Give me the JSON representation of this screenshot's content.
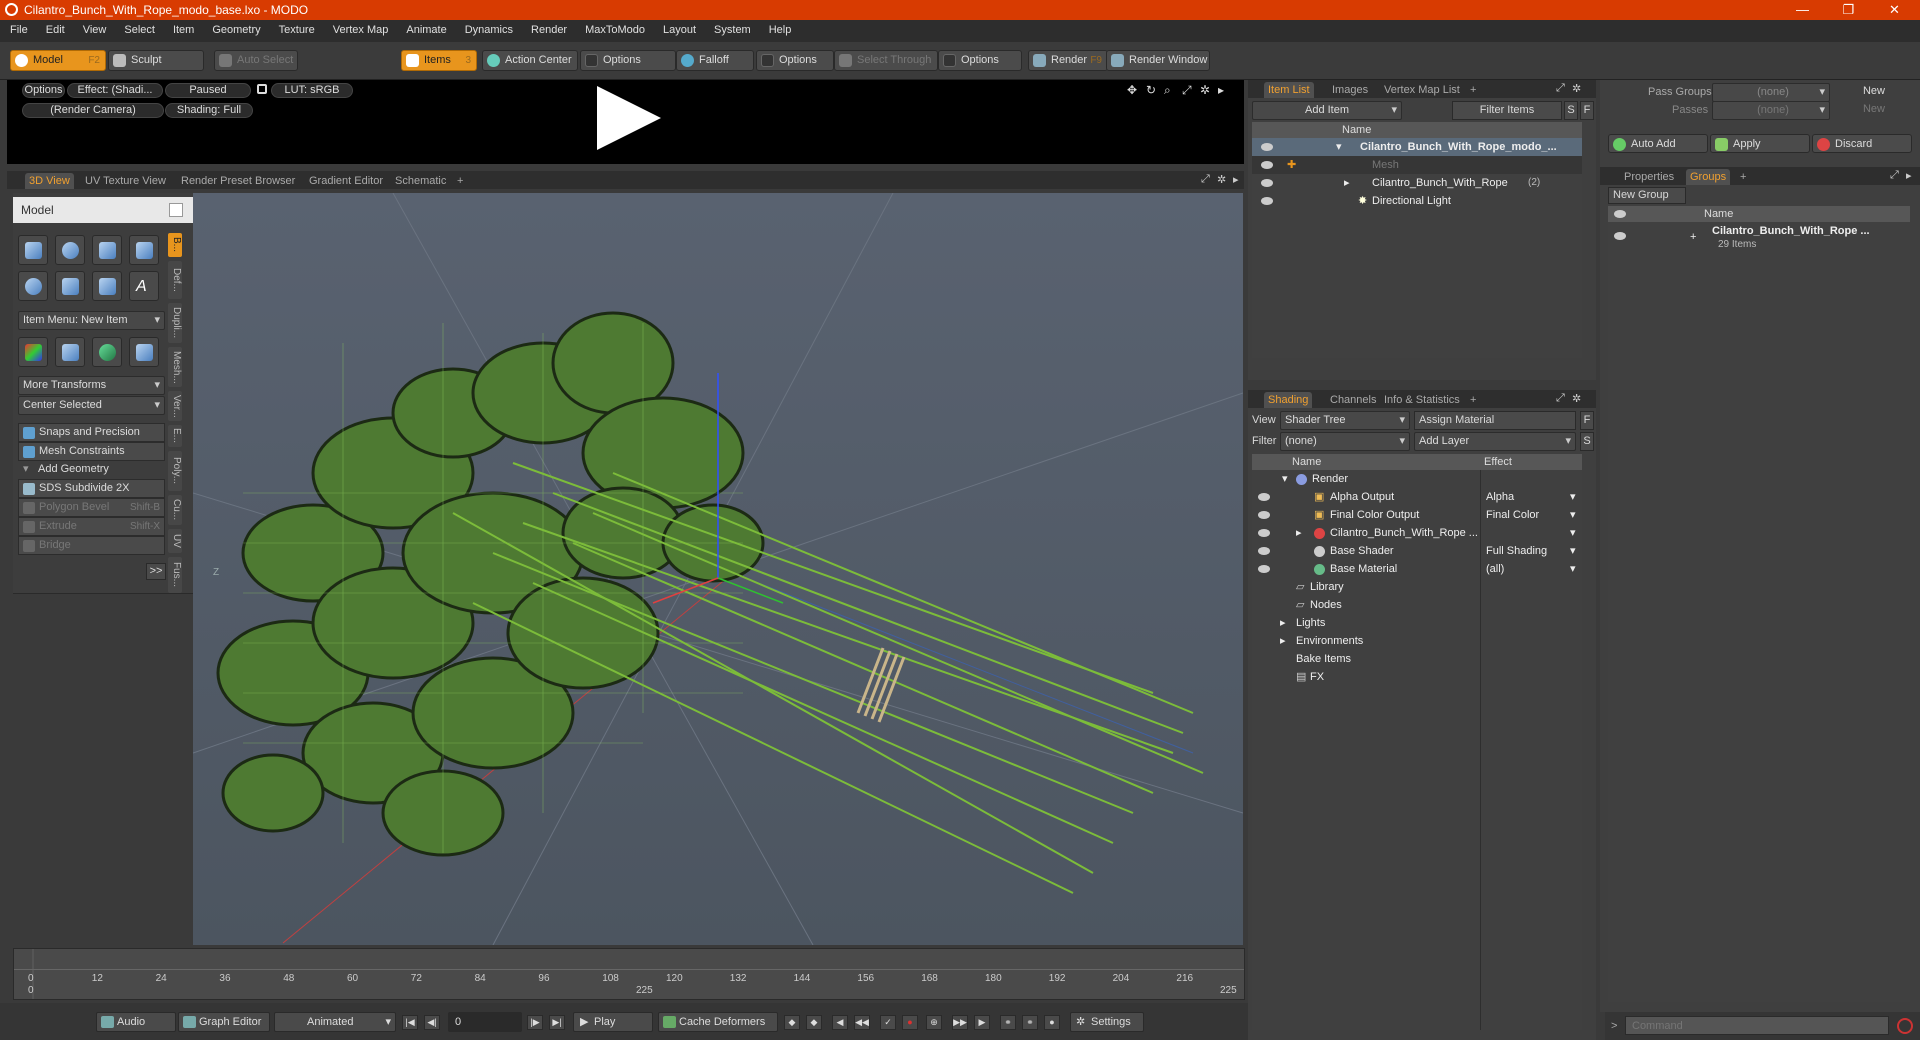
{
  "window": {
    "title": "Cilantro_Bunch_With_Rope_modo_base.lxo - MODO",
    "controls": [
      "—",
      "❐",
      "✕"
    ]
  },
  "menu": [
    "File",
    "Edit",
    "View",
    "Select",
    "Item",
    "Geometry",
    "Texture",
    "Vertex Map",
    "Animate",
    "Dynamics",
    "Render",
    "MaxToModo",
    "Layout",
    "System",
    "Help"
  ],
  "toolbar": {
    "model": "Model",
    "model_key": "F2",
    "sculpt": "Sculpt",
    "auto_select": "Auto Select",
    "items": "Items",
    "items_key": "3",
    "action_center": "Action Center",
    "options1": "Options",
    "falloff": "Falloff",
    "options2": "Options",
    "select_through": "Select Through",
    "options3": "Options",
    "render": "Render",
    "render_key": "F9",
    "render_window": "Render Window"
  },
  "video": {
    "options": "Options",
    "effect": "Effect: (Shadi...",
    "paused": "Paused",
    "lut": "LUT: sRGB",
    "camera": "(Render Camera)",
    "shading": "Shading: Full"
  },
  "viewtabs": [
    "3D View",
    "UV Texture View",
    "Render Preset Browser",
    "Gradient Editor",
    "Schematic",
    "+"
  ],
  "left": {
    "title": "Model",
    "item_menu": "Item Menu: New Item",
    "more_transforms": "More Transforms",
    "center_selected": "Center Selected",
    "snaps": "Snaps and Precision",
    "mesh_constraints": "Mesh Constraints",
    "add_geometry": "Add Geometry",
    "sds": "SDS Subdivide 2X",
    "poly_bevel": "Polygon Bevel",
    "poly_bevel_key": "Shift-B",
    "extrude": "Extrude",
    "extrude_key": "Shift-X",
    "bridge": "Bridge",
    "more": ">>",
    "sidetabs": [
      "B...",
      "Def...",
      "Dupli...",
      "Mesh...",
      "Ver...",
      "E...",
      "Poly...",
      "Cu...",
      "UV",
      "Fus..."
    ]
  },
  "viewport": {
    "axis_z": "Z"
  },
  "timeline": {
    "ticks": [
      "0",
      "12",
      "24",
      "36",
      "48",
      "60",
      "72",
      "84",
      "96",
      "108",
      "120",
      "132",
      "144",
      "156",
      "168",
      "180",
      "192",
      "204",
      "216"
    ],
    "ticks2": [
      "0",
      "225",
      "225"
    ]
  },
  "bottom": {
    "audio": "Audio",
    "graph_editor": "Graph Editor",
    "animated": "Animated",
    "frame": "0",
    "play": "Play",
    "cache": "Cache Deformers",
    "settings": "Settings"
  },
  "itemlist": {
    "tabs": [
      "Item List",
      "Images",
      "Vertex Map List",
      "+"
    ],
    "add_item": "Add Item",
    "filter": "Filter Items",
    "s": "S",
    "f": "F",
    "name_col": "Name",
    "rows": [
      {
        "label": "Cilantro_Bunch_With_Rope_modo_...",
        "bold": true
      },
      {
        "label": "Mesh",
        "dim": true
      },
      {
        "label": "Cilantro_Bunch_With_Rope",
        "extra": "(2)"
      },
      {
        "label": "Directional Light"
      }
    ]
  },
  "shading": {
    "tabs": [
      "Shading",
      "Channels",
      "Info & Statistics",
      "+"
    ],
    "view_label": "View",
    "view": "Shader Tree",
    "assign": "Assign Material",
    "filter_label": "Filter",
    "filter": "(none)",
    "add_layer": "Add Layer",
    "name_col": "Name",
    "effect_col": "Effect",
    "rows": [
      {
        "label": "Render",
        "effect": ""
      },
      {
        "label": "Alpha Output",
        "effect": "Alpha"
      },
      {
        "label": "Final Color Output",
        "effect": "Final Color"
      },
      {
        "label": "Cilantro_Bunch_With_Rope ...",
        "effect": ""
      },
      {
        "label": "Base Shader",
        "effect": "Full Shading"
      },
      {
        "label": "Base Material",
        "effect": "(all)"
      },
      {
        "label": "Library",
        "effect": ""
      },
      {
        "label": "Nodes",
        "effect": ""
      },
      {
        "label": "Lights",
        "effect": ""
      },
      {
        "label": "Environments",
        "effect": ""
      },
      {
        "label": "Bake Items",
        "effect": ""
      },
      {
        "label": "FX",
        "effect": ""
      }
    ]
  },
  "rightpanel": {
    "pass_groups": "Pass Groups",
    "passes": "Passes",
    "none": "(none)",
    "new": "New",
    "auto_add": "Auto Add",
    "apply": "Apply",
    "discard": "Discard",
    "tabs": [
      "Properties",
      "Groups",
      "+"
    ],
    "new_group": "New Group",
    "name_col": "Name",
    "group_name": "Cilantro_Bunch_With_Rope ...",
    "group_count": "29 Items"
  },
  "command": {
    "placeholder": "Command"
  }
}
